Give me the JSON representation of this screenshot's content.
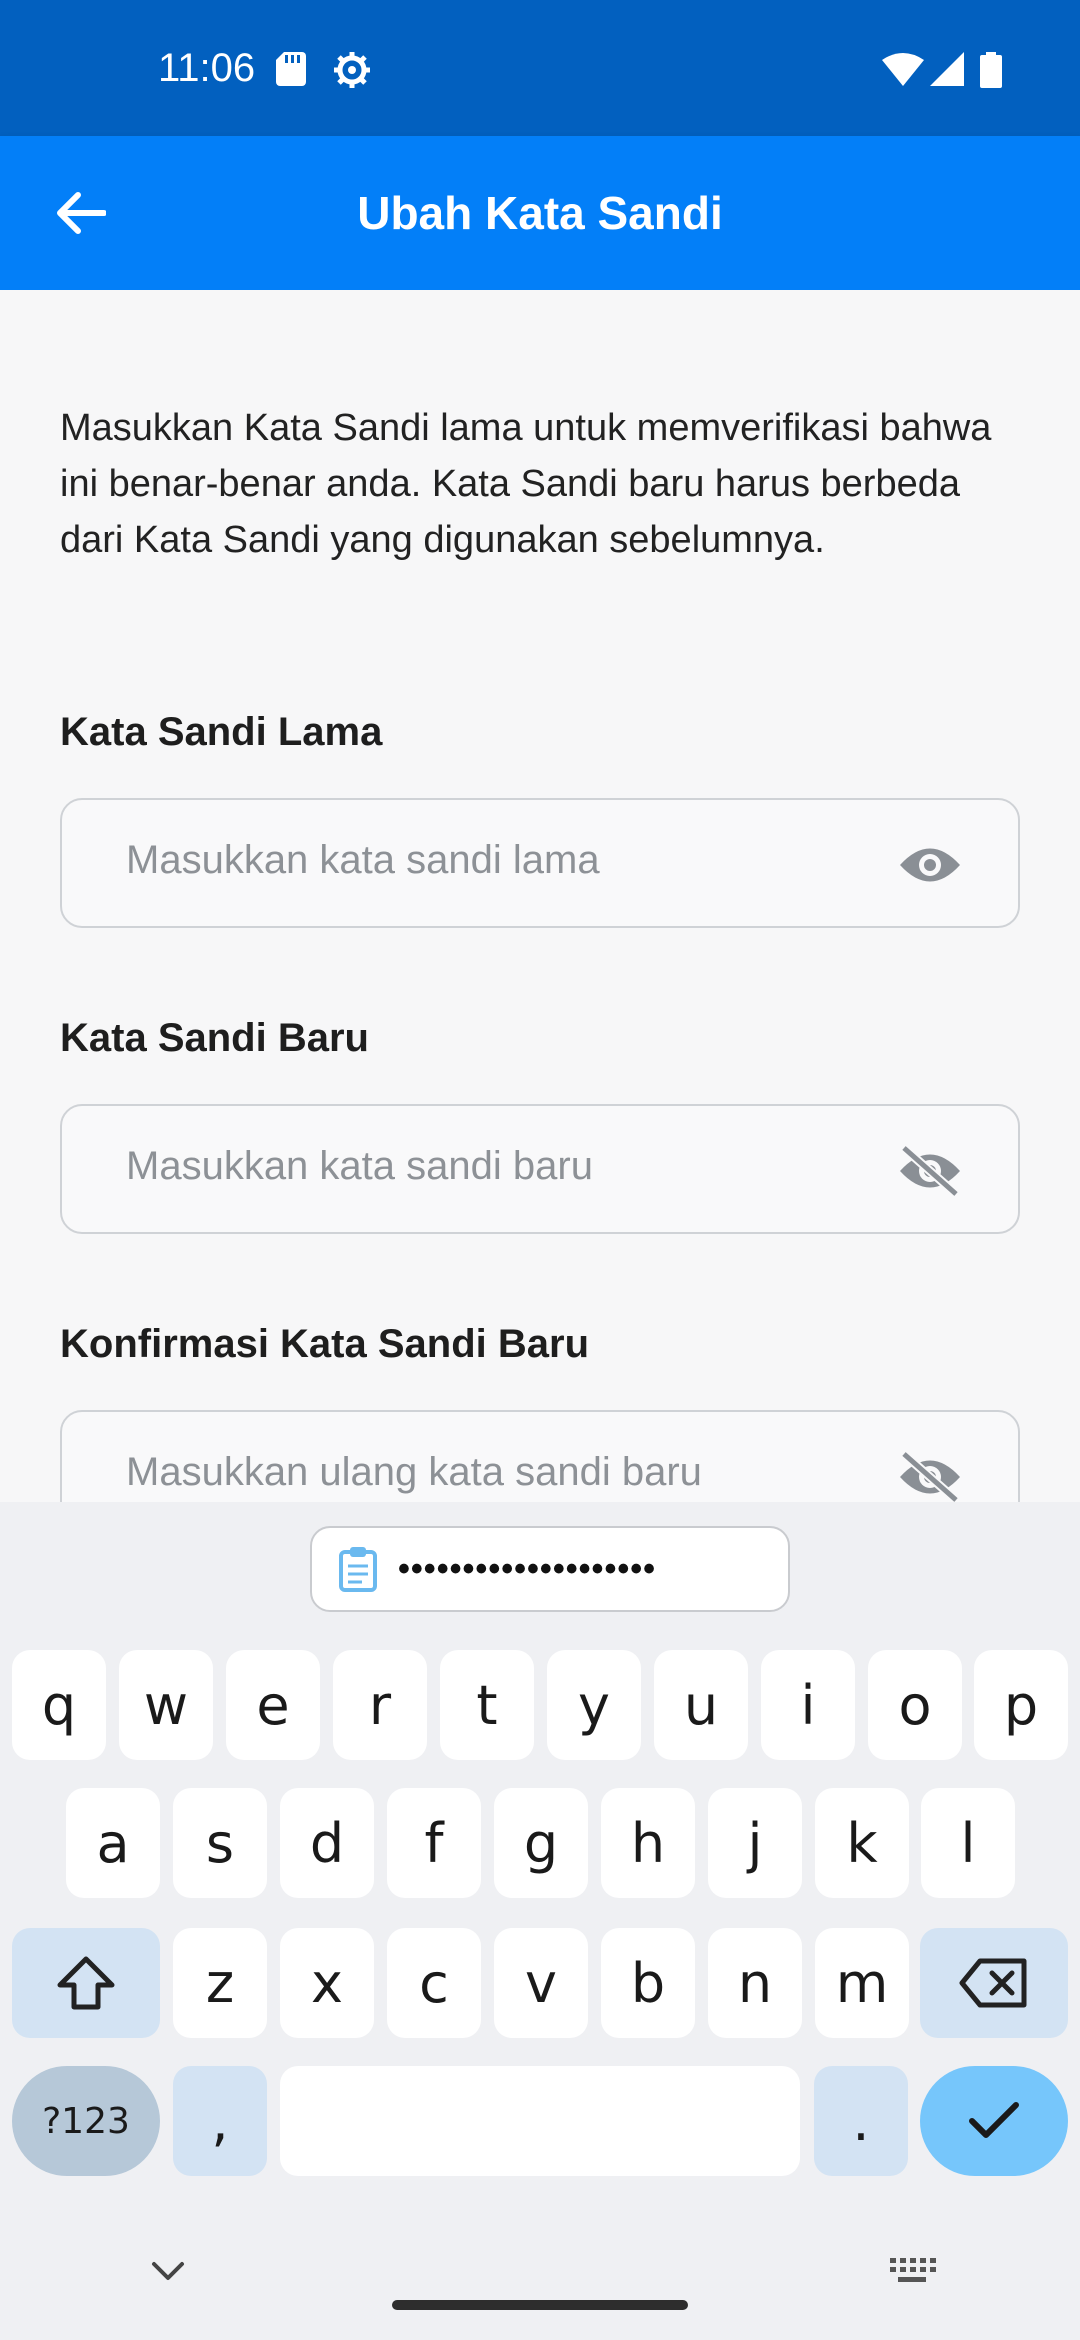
{
  "status_bar": {
    "time": "11:06",
    "icons": [
      "sdcard-icon",
      "settings-icon",
      "wifi-icon",
      "signal-icon",
      "battery-icon"
    ]
  },
  "app_bar": {
    "title": "Ubah Kata Sandi",
    "back_icon": "arrow-left-icon",
    "color": "#037ff8"
  },
  "description": "Masukkan Kata Sandi lama untuk memverifikasi bahwa ini benar-benar anda. Kata Sandi baru harus berbeda dari Kata Sandi yang digunakan sebelumnya.",
  "fields": {
    "old": {
      "label": "Kata Sandi Lama",
      "placeholder": "Masukkan kata sandi lama",
      "icon": "eye-icon"
    },
    "new": {
      "label": "Kata Sandi Baru",
      "placeholder": "Masukkan kata sandi baru",
      "icon": "eye-off-icon"
    },
    "confirm": {
      "label": "Konfirmasi Kata Sandi Baru",
      "placeholder": "Masukkan ulang kata sandi baru",
      "icon": "eye-off-icon"
    }
  },
  "keyboard": {
    "clipboard_text": "••••••••••••••••••••",
    "row1": [
      "q",
      "w",
      "e",
      "r",
      "t",
      "y",
      "u",
      "i",
      "o",
      "p"
    ],
    "row2": [
      "a",
      "s",
      "d",
      "f",
      "g",
      "h",
      "j",
      "k",
      "l"
    ],
    "row3": [
      "z",
      "x",
      "c",
      "v",
      "b",
      "n",
      "m"
    ],
    "symbols_label": "?123",
    "comma": ",",
    "period": "."
  }
}
